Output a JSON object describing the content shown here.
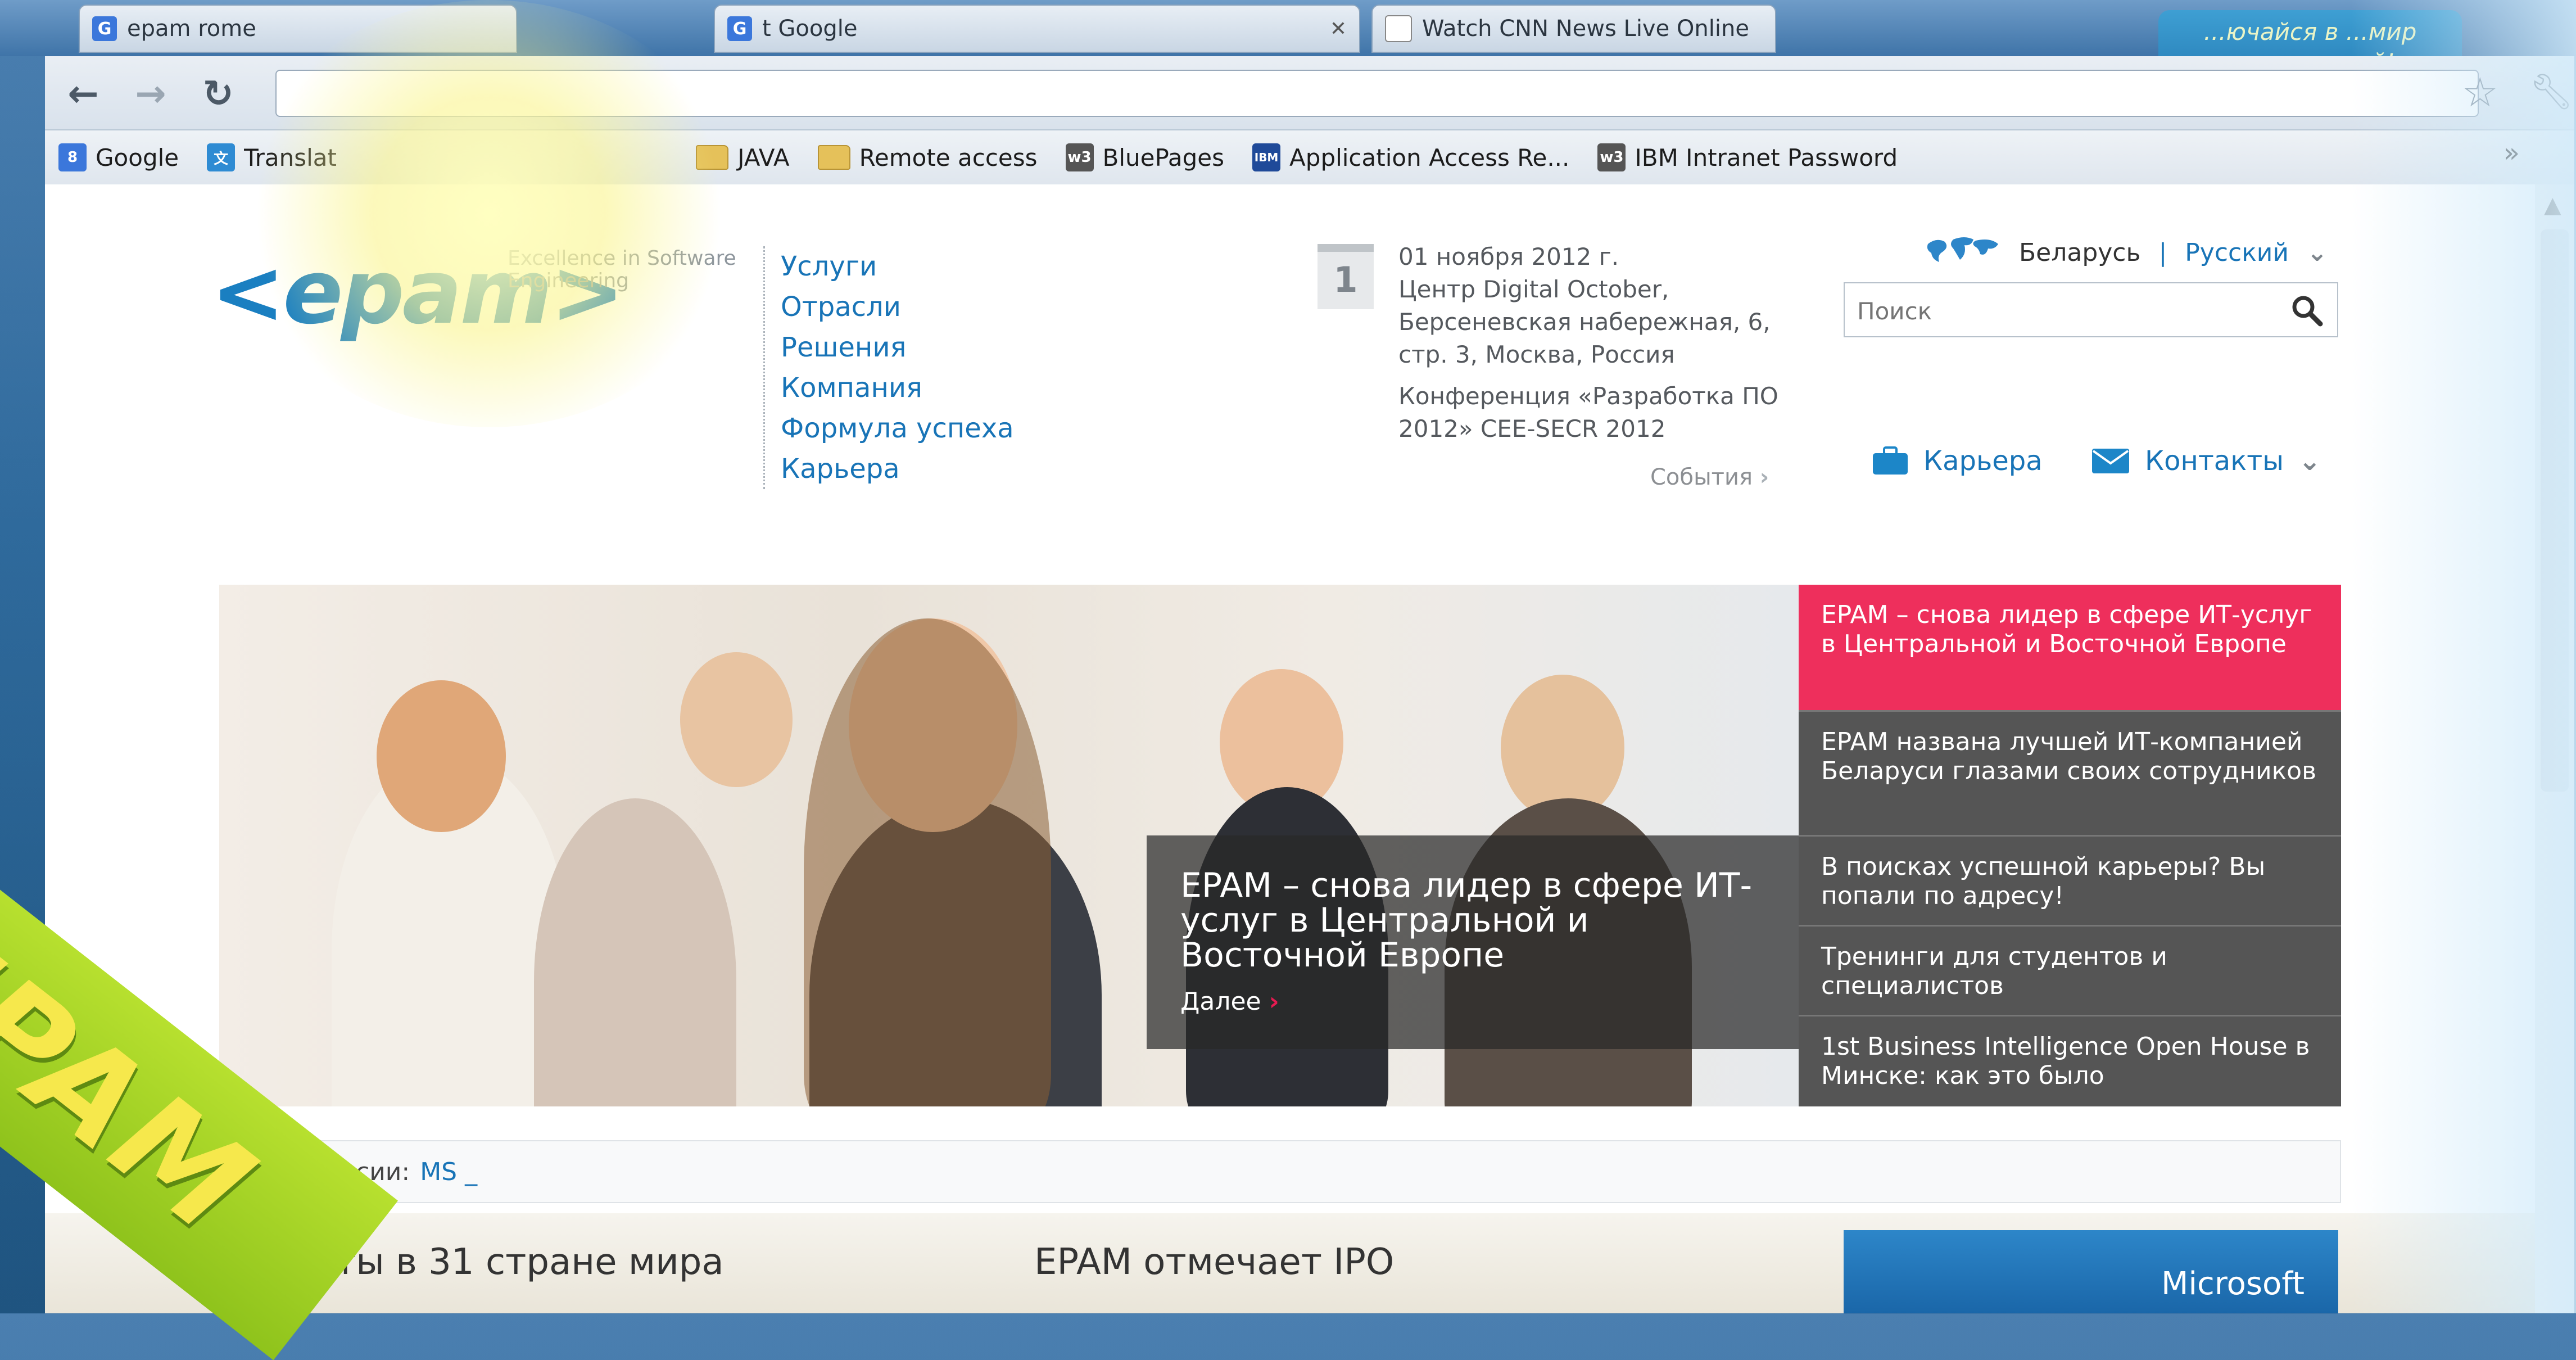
{
  "tabs": [
    {
      "title": "epam rome",
      "favicon": "G",
      "favicon_color": "#3b77db"
    },
    {
      "title": "t Google",
      "favicon": "G",
      "favicon_color": "#3b77db"
    },
    {
      "title": "Watch CNN News Live Online",
      "favicon": "page",
      "favicon_color": "#888888"
    }
  ],
  "toolbar": {
    "back_icon": "back-arrow-icon",
    "forward_icon": "forward-arrow-icon",
    "reload_icon": "reload-icon",
    "address": ""
  },
  "bookmarks": [
    {
      "label": "Google",
      "icon": "google-icon",
      "color": "#3b77db"
    },
    {
      "label": "Translat",
      "icon": "translate-icon",
      "color": "#2e8bd3"
    },
    {
      "label": "JAVA",
      "icon": "folder-icon",
      "color": "#e5c15a"
    },
    {
      "label": "Remote access",
      "icon": "folder-icon",
      "color": "#e5c15a"
    },
    {
      "label": "BluePages",
      "icon": "w3-icon",
      "color": "#555555"
    },
    {
      "label": "Application Access Re...",
      "icon": "ibm-icon",
      "color": "#1f4a99"
    },
    {
      "label": "IBM Intranet Password",
      "icon": "w3-icon",
      "color": "#555555"
    }
  ],
  "bookmarks_more": "»",
  "site": {
    "logo": "<epam>",
    "tagline": "Excellence in Software Engineering",
    "nav": [
      "Услуги",
      "Отрасли",
      "Решения",
      "Компания",
      "Формула успеха",
      "Карьера"
    ],
    "event": {
      "day": "1",
      "date": "01 ноября 2012 г.",
      "location": "Центр Digital October, Берсеневская набережная, 6, стр. 3, Москва, Россия",
      "title": "Конференция «Разработка ПО 2012» CEE-SECR 2012",
      "link": "События"
    },
    "region": {
      "country": "Беларусь",
      "separator": "|",
      "language": "Русский"
    },
    "search": {
      "placeholder": "Поиск"
    },
    "careers": "Карьера",
    "contacts": "Контакты",
    "hero": {
      "title": "EPAM – снова лидер в сфере ИТ-услуг в Центральной и Восточной Европе",
      "more": "Далее"
    },
    "news": [
      "EPAM – снова лидер в сфере ИТ-услуг в Центральной и Восточной Европе",
      "EPAM названа лучшей ИТ-компанией Беларуси глазами своих сотрудников",
      "В поисках успешной карьеры? Вы попали по адресу!",
      "Тренинги для студентов и специалистов",
      "1st Business Intelligence Open House в Минске: как это было"
    ],
    "ticker": {
      "label": "ые вакансии:",
      "value": "MS _"
    },
    "bottom": {
      "projects": "Проекты в 31 стране мира",
      "ipo": "EPAM отмечает IPO",
      "partner": "Microsoft"
    }
  },
  "overlay": {
    "ribbon": "EPAM",
    "promo": "...ючайся в ...мир развлечений!"
  },
  "colors": {
    "accent": "#1874b7",
    "highlight": "#ee2f5c",
    "logo": "#1a7fc1"
  }
}
